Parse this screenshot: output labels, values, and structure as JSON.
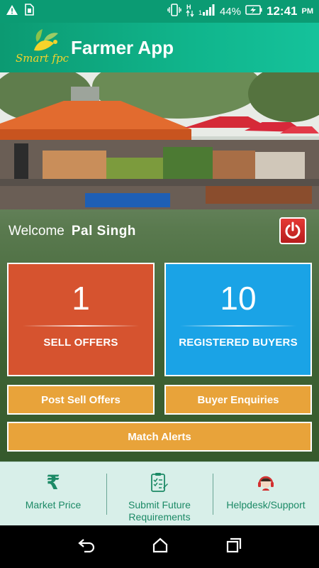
{
  "status_bar": {
    "battery": "44%",
    "time": "12:41",
    "ampm": "PM"
  },
  "app_bar": {
    "logo_text": "Smart fpc",
    "title": "Farmer App"
  },
  "welcome": {
    "label": "Welcome",
    "name": "Pal  Singh"
  },
  "stats": {
    "sell_offers_count": "1",
    "sell_offers_label": "SELL OFFERS",
    "registered_buyers_count": "10",
    "registered_buyers_label": "REGISTERED BUYERS"
  },
  "actions": {
    "post_sell_offers": "Post Sell Offers",
    "buyer_enquiries": "Buyer Enquiries",
    "match_alerts": "Match Alerts"
  },
  "bottom_nav": {
    "market_price": "Market Price",
    "submit_future_line1": "Submit Future",
    "submit_future_line2": "Requirements",
    "helpdesk": "Helpdesk/Support",
    "rupee_symbol": "₹"
  },
  "colors": {
    "primary_green": "#0b9b73",
    "sell_card": "#d6532f",
    "buyers_card": "#1aa3e6",
    "action_button": "#e8a33a",
    "nav_text": "#1c8a66"
  }
}
